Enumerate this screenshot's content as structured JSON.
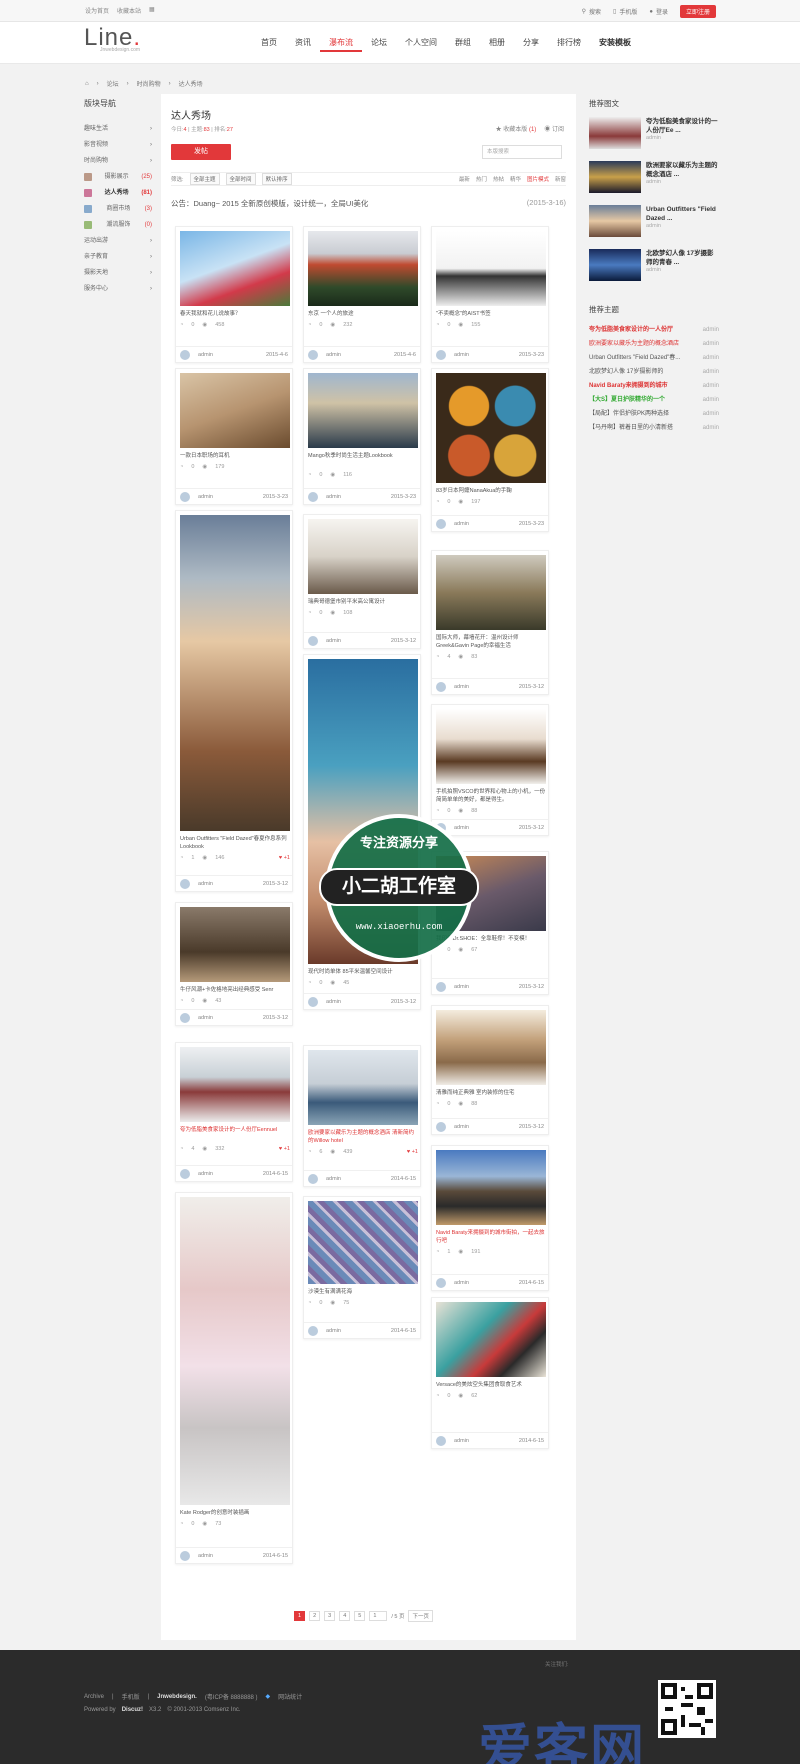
{
  "topbar": {
    "left": [
      "设为首页",
      "收藏本站"
    ],
    "search": "搜索",
    "mobile": "手机版",
    "user": "登录",
    "register": "立即注册"
  },
  "logo": {
    "text": "Line",
    "sub": "Jnwebdesign.com"
  },
  "nav": [
    "首页",
    "资讯",
    "瀑布流",
    "论坛",
    "个人空间",
    "群组",
    "相册",
    "分享",
    "排行榜",
    "安装模板"
  ],
  "crumb": [
    "论坛",
    "时尚购物",
    "达人秀场"
  ],
  "left": {
    "title": "版块导航",
    "items": [
      {
        "label": "趣味生活"
      },
      {
        "label": "影音视频"
      },
      {
        "label": "时尚购物"
      },
      {
        "label": "摄影展示",
        "count": "(25)",
        "sub": true
      },
      {
        "label": "达人秀场",
        "count": "(81)",
        "sub": true,
        "active": true
      },
      {
        "label": "商圈市场",
        "count": "(3)",
        "sub": true
      },
      {
        "label": "潮流服饰",
        "count": "(0)",
        "sub": true
      },
      {
        "label": "运动出游"
      },
      {
        "label": "亲子教育"
      },
      {
        "label": "摄影天地"
      },
      {
        "label": "服务中心"
      }
    ]
  },
  "main": {
    "title": "达人秀场",
    "stats": {
      "today_label": "今日:",
      "today": "4",
      "topics_label": "主题:",
      "topics": "83",
      "rank_label": "排名:",
      "rank": "27"
    },
    "fav": "收藏本版",
    "fav_count": "(1)",
    "rss": "订阅",
    "post": "发帖",
    "search_placeholder": "本版搜索",
    "filter": {
      "label": "筛选:",
      "s1": "全部主题",
      "s2": "全部时间",
      "s3": "默认排序",
      "sorts": [
        "最新",
        "热门",
        "热帖",
        "精华",
        "图片模式",
        "新窗"
      ]
    },
    "notice": "公告：Duang~   2015 全新原创模版，设计统一，全局UI美化",
    "notice_date": "(2015-3-16)"
  },
  "cards": [
    {
      "cap": "春天我就和花儿说故事？",
      "v": "0",
      "c": "458",
      "user": "admin",
      "date": "2015-4-6"
    },
    {
      "cap": "东京 一个人的旅途",
      "v": "0",
      "c": "232",
      "user": "admin",
      "date": "2015-4-6"
    },
    {
      "cap": "\"不卖概念\"的AIST书签",
      "v": "0",
      "c": "155",
      "user": "admin",
      "date": "2015-3-23"
    },
    {
      "cap": "一款日本职场的耳机",
      "v": "0",
      "c": "179",
      "user": "admin",
      "date": "2015-3-23"
    },
    {
      "cap": "Mango秋季时尚生活主题Lookbook",
      "v": "0",
      "c": "116",
      "user": "admin",
      "date": "2015-3-23"
    },
    {
      "cap": "83岁日本阿嬷NanaAkua的手鞠",
      "v": "0",
      "c": "197",
      "user": "admin",
      "date": "2015-3-23"
    },
    {
      "cap": "Urban Outfitters \"Field Dazed\"春夏作息系列Lookbook",
      "v": "1",
      "c": "146",
      "likes": "+1",
      "user": "admin",
      "date": "2015-3-12"
    },
    {
      "cap": "瑞典哥德堡市别平米高公寓设计",
      "v": "0",
      "c": "108",
      "user": "admin",
      "date": "2015-3-12"
    },
    {
      "cap": "国际大师，幕墙花开：温州设计师Greek&Gavin Page的幸福生活",
      "v": "4",
      "c": "83",
      "user": "admin",
      "date": "2015-3-12"
    },
    {
      "cap": "现代时尚单体 85平米温馨空间设计",
      "v": "0",
      "c": "45",
      "user": "admin",
      "date": "2015-3-12"
    },
    {
      "cap": "手机拍照VSCO的世界和心物上的小机，一份简简单单的美好，都是得生。",
      "v": "0",
      "c": "88",
      "user": "admin",
      "date": "2015-3-12"
    },
    {
      "cap": "我印你Dr.SHOE：全靠鞋撑！不变模！",
      "v": "0",
      "c": "67",
      "user": "admin",
      "date": "2015-3-12"
    },
    {
      "cap": "牛仔风潮+卡佐格地亮出经典感受 Senr",
      "v": "0",
      "c": "43",
      "user": "admin",
      "date": "2015-3-12"
    },
    {
      "cap": "夸为低脂美食家设计的一人份厅Eennuel",
      "v": "4",
      "c": "332",
      "likes": "+1",
      "user": "admin",
      "date": "2014-6-15",
      "red": true
    },
    {
      "cap": "欧洲要家以藏乐为主题的概念酒店 清新简约的Willow hotel",
      "v": "6",
      "c": "439",
      "likes": "+1",
      "user": "admin",
      "date": "2014-6-15",
      "red": true
    },
    {
      "cap": "清雅而纯正典雅 室内装修的住宅",
      "v": "0",
      "c": "88",
      "user": "admin",
      "date": "2015-3-12"
    },
    {
      "cap": "Navid Baraty来拥摄到的城市街拍，一起去旅行吧",
      "v": "1",
      "c": "191",
      "user": "admin",
      "date": "2014-6-15",
      "red": true
    },
    {
      "cap": "沙漠生有满满花海",
      "v": "0",
      "c": "75",
      "user": "admin",
      "date": "2014-6-15"
    },
    {
      "cap": "Kate Rodger的创意时装插画",
      "v": "0",
      "c": "73",
      "user": "admin",
      "date": "2014-6-15"
    },
    {
      "cap": "Versace的美炫空头集团食取食艺术",
      "v": "0",
      "c": "62",
      "user": "admin",
      "date": "2014-6-15"
    }
  ],
  "pager": {
    "pages": [
      "1",
      "2",
      "3",
      "4",
      "5"
    ],
    "input": "1",
    "total": "/ 5 页",
    "next": "下一页"
  },
  "right": {
    "title1": "推荐图文",
    "pics": [
      {
        "t": "夸为低脂美食家设计的一人份厅Ee ...",
        "by": "admin"
      },
      {
        "t": "欧洲要家以藏乐为主题的概念酒店 ...",
        "by": "admin"
      },
      {
        "t": "Urban Outfitters \"Field Dazed ...",
        "by": "admin"
      },
      {
        "t": "北欧梦幻人像 17岁摄影师的青春 ...",
        "by": "admin"
      }
    ],
    "title2": "推荐主题",
    "topics": [
      {
        "t": "夸为低脂美食家设计的一人份厅",
        "a": "admin",
        "c": "#d33",
        "b": true
      },
      {
        "t": "欧洲要家以藏乐为主题的概念酒店",
        "a": "admin",
        "c": "#d33"
      },
      {
        "t": "Urban Outfitters \"Field Dazed\"春...",
        "a": "admin"
      },
      {
        "t": "北欧梦幻人像 17岁摄影师的",
        "a": "admin"
      },
      {
        "t": "Navid Baraty来拥摄到的城市",
        "a": "admin",
        "c": "#d33",
        "b": true
      },
      {
        "t": "【大S】夏日护肤精华的一个",
        "a": "admin",
        "c": "#3a3",
        "b": true
      },
      {
        "t": "【局配】伴侣护肤PK两种选择",
        "a": "admin"
      },
      {
        "t": "【马丹啊】裤着日里的小清新搭",
        "a": "admin"
      }
    ]
  },
  "footer": {
    "follow": "关注我们:",
    "links": [
      "Archive",
      "手机版",
      "Jnwebdesign.",
      "(粤ICP备 8888888 )",
      "网站统计"
    ],
    "powered": "Powered by",
    "discuz": "Discuz!",
    "ver": "X3.2",
    "copy": "© 2001-2013 Comsenz Inc."
  },
  "watermark": {
    "top": "专注资源分享",
    "band": "小二胡工作室",
    "url": "www.xiaoerhu.com",
    "big": "爱客网"
  }
}
